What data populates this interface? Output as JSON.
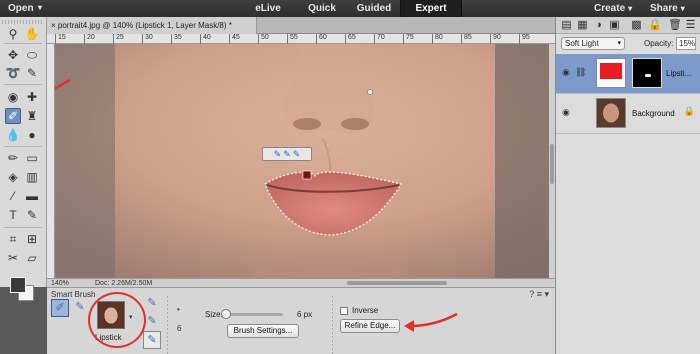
{
  "topbar": {
    "open_label": "Open",
    "modes": [
      "eLive",
      "Quick",
      "Guided",
      "Expert"
    ],
    "active_mode": "Expert",
    "create_label": "Create",
    "share_label": "Share"
  },
  "document": {
    "tab_close": "×",
    "tab_title": "portrait4.jpg @ 140% (Lipstick 1, Layer Mask/8) *",
    "ruler_ticks": [
      "15",
      "20",
      "25",
      "30",
      "35",
      "40",
      "45",
      "50",
      "55",
      "60",
      "65",
      "70",
      "75",
      "80",
      "85",
      "90",
      "95"
    ],
    "status_zoom": "140%",
    "status_doc": "Doc: 2.26M/2.50M"
  },
  "layers_panel": {
    "blend_mode": "Soft Light",
    "opacity_label": "Opacity:",
    "opacity_value": "15%",
    "layers": [
      {
        "name": "Lipsti...",
        "selected": true
      },
      {
        "name": "Background",
        "selected": false
      }
    ]
  },
  "tool_options": {
    "title": "Smart Brush",
    "preset_label": "Lipstick",
    "size_label": "Size:",
    "size_value": "6 px",
    "small_num_1": "•",
    "small_num_2": "6",
    "brush_settings_label": "Brush Settings...",
    "inverse_label": "Inverse",
    "refine_edge_label": "Refine Edge..."
  },
  "colors": {
    "accent_red": "#e0302a",
    "selection_blue": "#7c9bcc",
    "layer_fill_red": "#ea1c24"
  }
}
